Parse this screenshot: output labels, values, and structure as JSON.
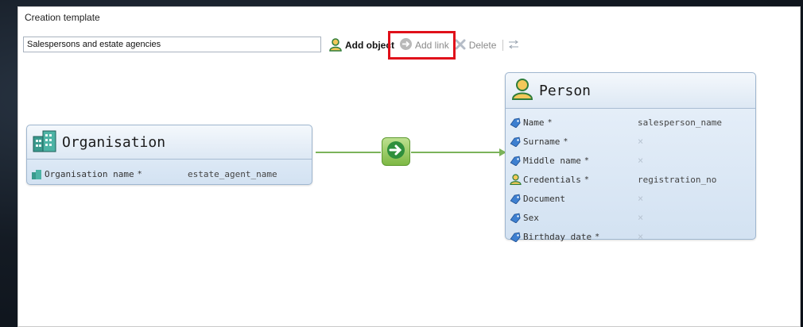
{
  "panel": {
    "title": "Creation template"
  },
  "template_name": {
    "value": "Salespersons and estate agencies"
  },
  "toolbar": {
    "add_object": "Add object",
    "add_link": "Add link",
    "delete": "Delete"
  },
  "organisation": {
    "title": "Organisation",
    "attributes": [
      {
        "name": "Organisation name",
        "required": "*",
        "value": "estate_agent_name"
      }
    ]
  },
  "person": {
    "title": "Person",
    "attributes": [
      {
        "icon": "tag-icon",
        "name": "Name",
        "required": "*",
        "value": "salesperson_name"
      },
      {
        "icon": "tag-icon",
        "name": "Surname",
        "required": "*",
        "value": "×"
      },
      {
        "icon": "tag-icon",
        "name": "Middle name",
        "required": "*",
        "value": "×"
      },
      {
        "icon": "person-icon",
        "name": "Credentials",
        "required": "*",
        "value": "registration_no"
      },
      {
        "icon": "tag-icon",
        "name": "Document",
        "required": "",
        "value": "×"
      },
      {
        "icon": "tag-icon",
        "name": "Sex",
        "required": "",
        "value": "×"
      },
      {
        "icon": "tag-icon",
        "name": "Birthday date",
        "required": "*",
        "value": "×"
      }
    ]
  },
  "colors": {
    "link": "#7bb35a",
    "highlight": "#e0101a",
    "node_border": "#9fb6cf"
  }
}
